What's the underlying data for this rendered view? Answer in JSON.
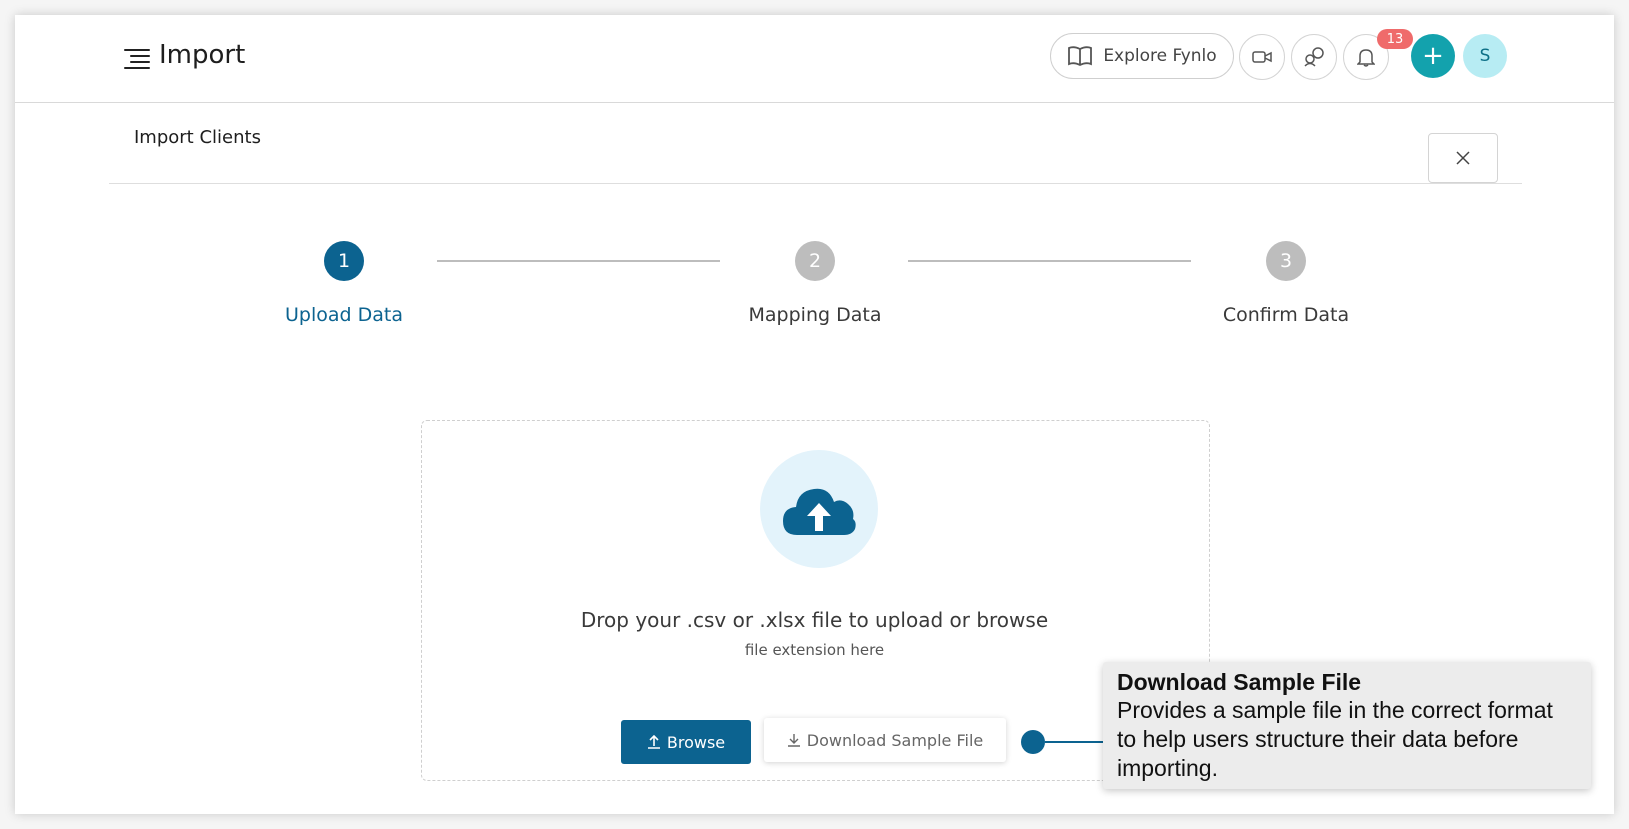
{
  "header": {
    "title": "Import",
    "explore_label": "Explore Fynlo",
    "notification_count": "13",
    "plus_label": "+",
    "avatar_initial": "S"
  },
  "section": {
    "title": "Import Clients",
    "close_label": "×"
  },
  "stepper": {
    "steps": [
      {
        "number": "1",
        "label": "Upload Data",
        "state": "active"
      },
      {
        "number": "2",
        "label": "Mapping Data",
        "state": "inactive"
      },
      {
        "number": "3",
        "label": "Confirm Data",
        "state": "inactive"
      }
    ]
  },
  "upload": {
    "instruction": "Drop your .csv or .xlsx file to upload or browse",
    "sub_instruction": "file extension here",
    "browse_label": "Browse",
    "sample_label": "Download Sample File"
  },
  "tooltip": {
    "title": "Download Sample File",
    "body": "Provides a sample file in the correct format to help users structure their data before importing."
  },
  "colors": {
    "primary": "#0c6390",
    "accent_teal": "#13a2ad",
    "badge_red": "#ef6b6b",
    "avatar_bg": "#b7ecf3",
    "step_inactive": "#bdbdbd",
    "cloud_bg": "#e3f3fb"
  }
}
